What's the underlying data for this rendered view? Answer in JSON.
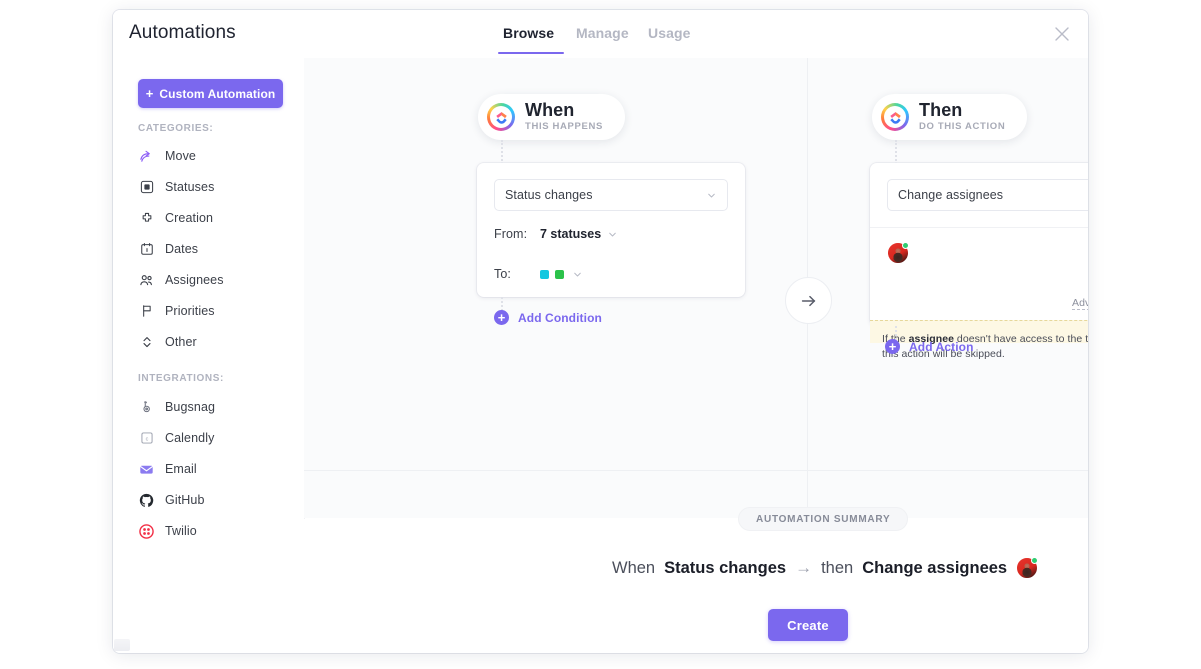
{
  "window": {
    "title": "Automations",
    "close_icon": "close-icon"
  },
  "tabs": [
    {
      "label": "Browse",
      "selected": true
    },
    {
      "label": "Manage",
      "selected": false
    },
    {
      "label": "Usage",
      "selected": false
    }
  ],
  "sidebar": {
    "custom_button": {
      "label": "Custom Automation",
      "icon": "plus-icon"
    },
    "categories_label": "CATEGORIES:",
    "categories": [
      {
        "label": "Move",
        "icon": "move-arrow-icon"
      },
      {
        "label": "Statuses",
        "icon": "status-square-icon"
      },
      {
        "label": "Creation",
        "icon": "plus-cross-icon"
      },
      {
        "label": "Dates",
        "icon": "calendar-icon"
      },
      {
        "label": "Assignees",
        "icon": "people-icon"
      },
      {
        "label": "Priorities",
        "icon": "flag-icon"
      },
      {
        "label": "Other",
        "icon": "updown-chevrons-icon"
      }
    ],
    "integrations_label": "INTEGRATIONS:",
    "integrations": [
      {
        "label": "Bugsnag",
        "icon": "bugsnag-icon"
      },
      {
        "label": "Calendly",
        "icon": "calendly-icon"
      },
      {
        "label": "Email",
        "icon": "email-icon"
      },
      {
        "label": "GitHub",
        "icon": "github-icon"
      },
      {
        "label": "Twilio",
        "icon": "twilio-icon"
      }
    ]
  },
  "trigger": {
    "pill_title": "When",
    "pill_subtitle": "THIS HAPPENS",
    "trigger_select": "Status changes",
    "from_label": "From:",
    "from_value": "7 statuses",
    "to_label": "To:",
    "to_swatches": [
      "#12c7e0",
      "#2bc24a"
    ],
    "add_condition": "Add Condition"
  },
  "connector": {
    "icon": "arrow-right-icon"
  },
  "action": {
    "pill_title": "Then",
    "pill_subtitle": "DO THIS ACTION",
    "action_select": "Change assignees",
    "assignee_avatar": "user-avatar",
    "advanced_link": "Advanced",
    "warning_prefix": "If the ",
    "warning_bold": "assignee",
    "warning_suffix": " doesn't have access to the task, this action will be skipped.",
    "add_action": "Add Action"
  },
  "summary": {
    "chip": "AUTOMATION SUMMARY",
    "when_word": "When",
    "trigger_text": "Status changes",
    "arrow": "→",
    "then_word": "then",
    "action_text": "Change assignees",
    "create_button": "Create"
  },
  "colors": {
    "accent": "#7b68ee",
    "canvas_bg": "#fafbfc",
    "warning_bg": "#fdf8e4",
    "warning_border": "#e6d79a",
    "status_online": "#2ecc71"
  }
}
